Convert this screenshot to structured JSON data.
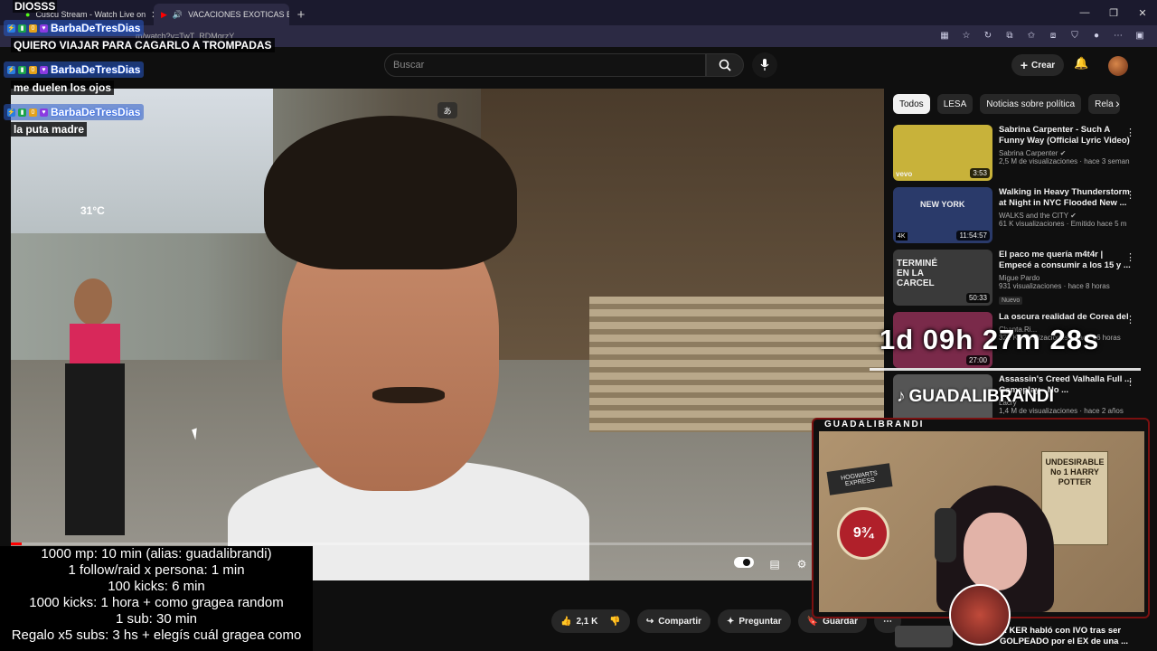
{
  "browser": {
    "tabs": [
      {
        "label": "Cuscu Stream - Watch Live on",
        "active": false
      },
      {
        "label": "VACACIONES EXOTICAS EN S",
        "active": true
      }
    ],
    "new_tab": "+",
    "address": "m/watch?v=TwT_RDMgrzY"
  },
  "youtube": {
    "search_placeholder": "Buscar",
    "create_label": "Crear",
    "chips": [
      "Todos",
      "LESA",
      "Noticias sobre política",
      "Rela"
    ],
    "actions": {
      "likes": "2,1 K",
      "share": "Compartir",
      "ask": "Preguntar",
      "save": "Guardar"
    },
    "recommendations": [
      {
        "title": "Sabrina Carpenter - Such A Funny Way (Official Lyric Video)",
        "channel": "Sabrina Carpenter",
        "meta": "2,5 M de visualizaciones · hace 3 seman",
        "duration": "3:53",
        "thumb_color": "#c8b23a",
        "new": ""
      },
      {
        "title": "Walking in Heavy Thunderstorm at Night in NYC Flooded New ...",
        "channel": "WALKS and the CITY",
        "meta": "61 K visualizaciones · Emitido hace 5 m",
        "duration": "11:54:57",
        "thumb_color": "#2a3a6a",
        "new": ""
      },
      {
        "title": "El paco me quería m4t4r | Empecé a consumir a los 15 y ...",
        "channel": "Migue Pardo",
        "meta": "931 visualizaciones · hace 8 horas",
        "duration": "50:33",
        "thumb_color": "#3a3a3a",
        "new": "Nuevo"
      },
      {
        "title": "La oscura realidad de Corea del",
        "channel": "Chanta.Ri...",
        "meta": "322 K visualizaciones · hace 16 horas",
        "duration": "27:00",
        "thumb_color": "#7a2a4a",
        "new": ""
      },
      {
        "title": "Assassin's Creed Valhalla Full ... Gameplay - No ...",
        "channel": "Lacry",
        "meta": "1,4 M de visualizaciones · hace 2 años",
        "duration": "",
        "thumb_color": "#555",
        "new": ""
      }
    ],
    "bottom_rec": "... KER habló con IVO tras ser GOLPEADO por el EX de una ..."
  },
  "thumb_texts": {
    "vevo": "vevo",
    "new_york": "NEW YORK",
    "termine": "TERMINÉ EN LA CARCEL",
    "four_k": "4K"
  },
  "video_overlay": {
    "temperature": "31°C"
  },
  "stream_overlay": {
    "top_note": "DIOSSS",
    "chat": [
      {
        "user": "BarbaDeTresDias",
        "message": "QUIERO VIAJAR PARA CAGARLO A TROMPADAS"
      },
      {
        "user": "BarbaDeTresDias",
        "message": "me duelen los ojos"
      },
      {
        "user": "BarbaDeTresDias",
        "message": "la puta madre"
      }
    ],
    "countdown": "1d 09h 27m 28s",
    "tiktok_handle": "GUADALIBRANDI",
    "cam_label": "GUADALIBRANDI",
    "rules": [
      "1000 mp: 10 min (alias: guadalibrandi)",
      "1 follow/raid x persona: 1 min",
      "100 kicks: 6 min",
      "1000 kicks: 1 hora + como gragea random",
      "1 sub: 30 min",
      "Regalo x5 subs: 3 hs + elegís cuál gragea como"
    ],
    "cam_poster": "UNDESIRABLE No 1 HARRY POTTER",
    "cam_sign": "HOGWARTS EXPRESS",
    "platform": "9¾"
  },
  "video_progress": 0.012,
  "colors": {
    "accent": "#ff0000",
    "chat_name": "#1256ff",
    "cam_border": "#7a1010"
  }
}
